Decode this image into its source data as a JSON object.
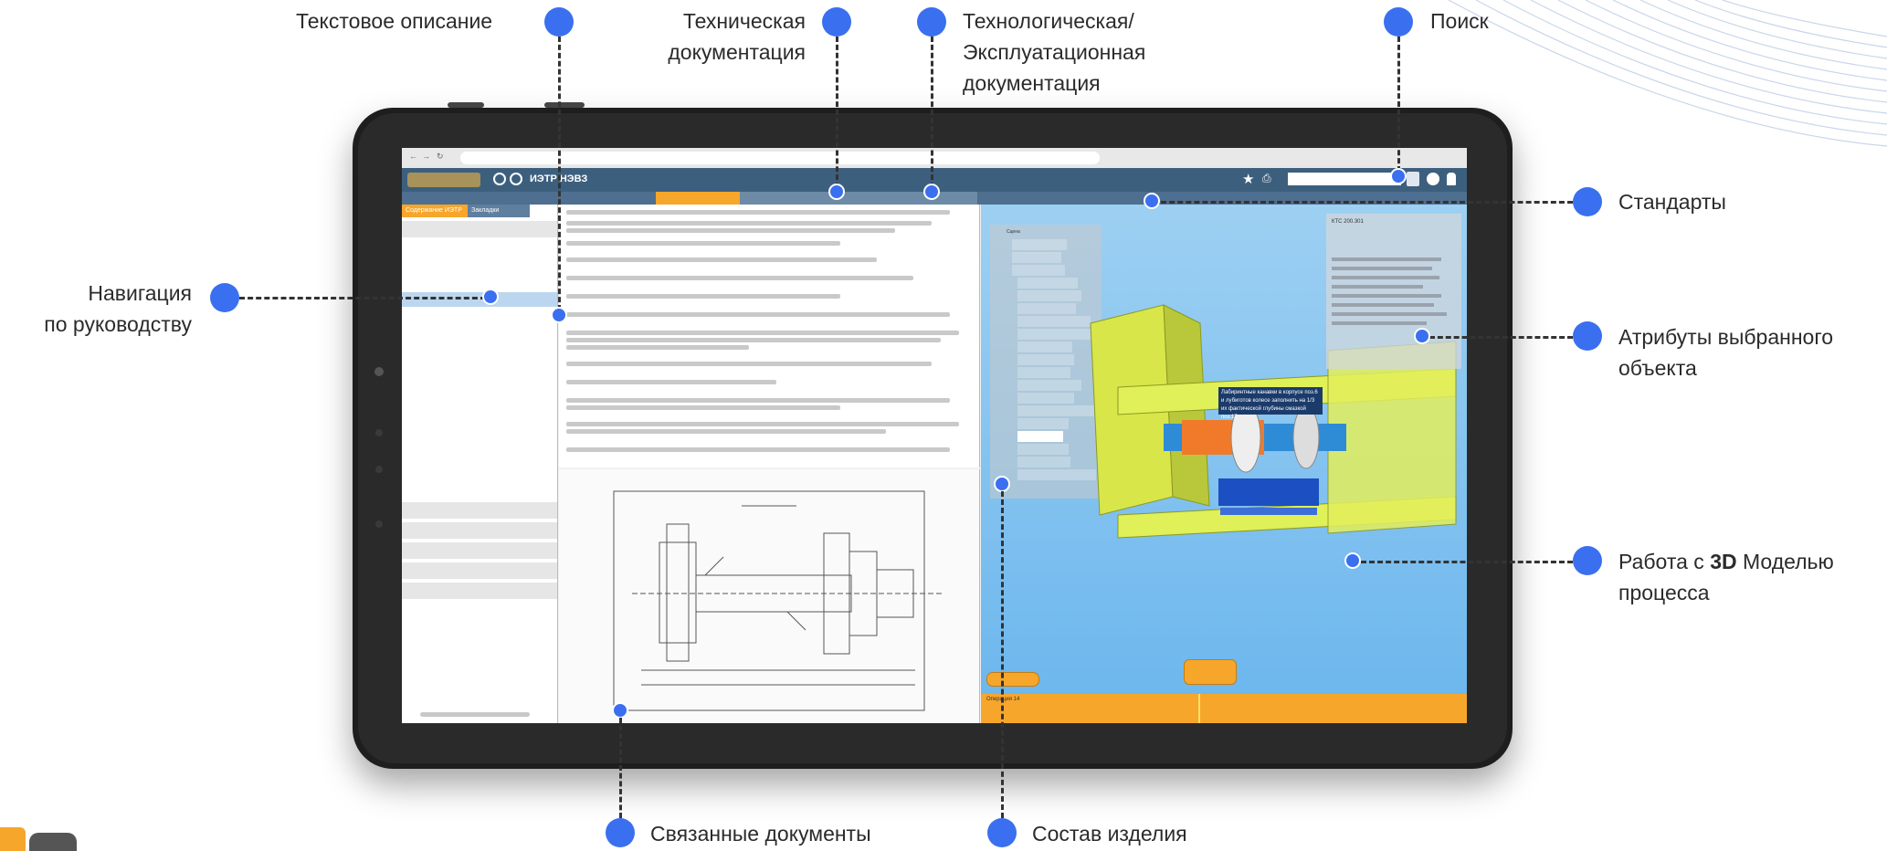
{
  "callouts": {
    "text_description": "Текстовое описание",
    "tech_docs_line1": "Техническая",
    "tech_docs_line2": "документация",
    "process_docs_line1": "Технологическая/",
    "process_docs_line2": "Эксплуатационная",
    "process_docs_line3": "документация",
    "search": "Поиск",
    "standards": "Стандарты",
    "navigation_line1": "Навигация",
    "navigation_line2": "по руководству",
    "attributes_line1": "Атрибуты выбранного",
    "attributes_line2": "объекта",
    "model_prefix": "Работа с ",
    "model_bold": "3D",
    "model_suffix": " Моделью",
    "model_line2": "процесса",
    "linked_docs": "Связанные документы",
    "product_structure": "Состав изделия"
  },
  "app": {
    "title": "ИЭТР НЭВЗ",
    "search_placeholder": "",
    "nav_tab_content": "Содержание ИЭТР",
    "nav_tab_bookmarks": "Закладки",
    "tree_root": "Сцена",
    "attr_title": "КТС 200.301",
    "tooltip_line1": "Лабиринтные канавки в корпусе поз.6",
    "tooltip_line2": "и лубиготов колесе заполнить на 1/3",
    "tooltip_line3": "их фактической глубины смазкой поз.17",
    "step_label": "Операция 14"
  },
  "colors": {
    "accent": "#3a6ff0",
    "appbar": "#3d5f7e",
    "orange": "#f7a62c"
  }
}
